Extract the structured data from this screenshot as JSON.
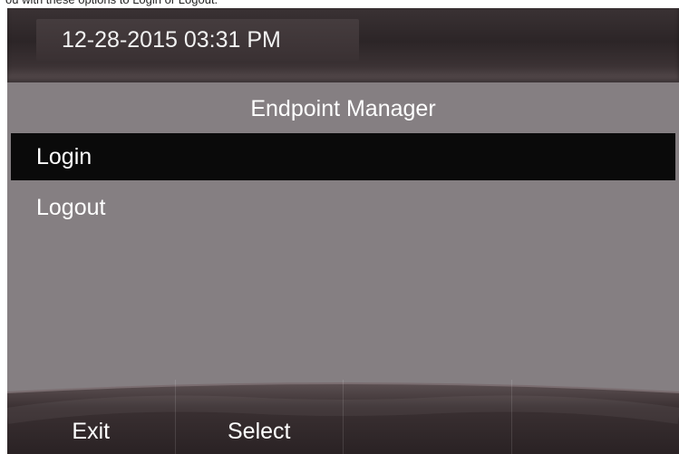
{
  "caption": "ou with these options to Login or Logout.",
  "status_bar": {
    "datetime": "12-28-2015 03:31 PM"
  },
  "screen": {
    "title": "Endpoint Manager"
  },
  "menu": {
    "items": [
      {
        "label": "Login",
        "selected": true
      },
      {
        "label": "Logout",
        "selected": false
      }
    ]
  },
  "softkeys": [
    {
      "label": "Exit"
    },
    {
      "label": "Select"
    },
    {
      "label": ""
    },
    {
      "label": ""
    }
  ],
  "colors": {
    "screen_background": "#857f82",
    "bar_dark": "#2c2527",
    "selection": "#0a0a0a",
    "text": "#ffffff"
  }
}
